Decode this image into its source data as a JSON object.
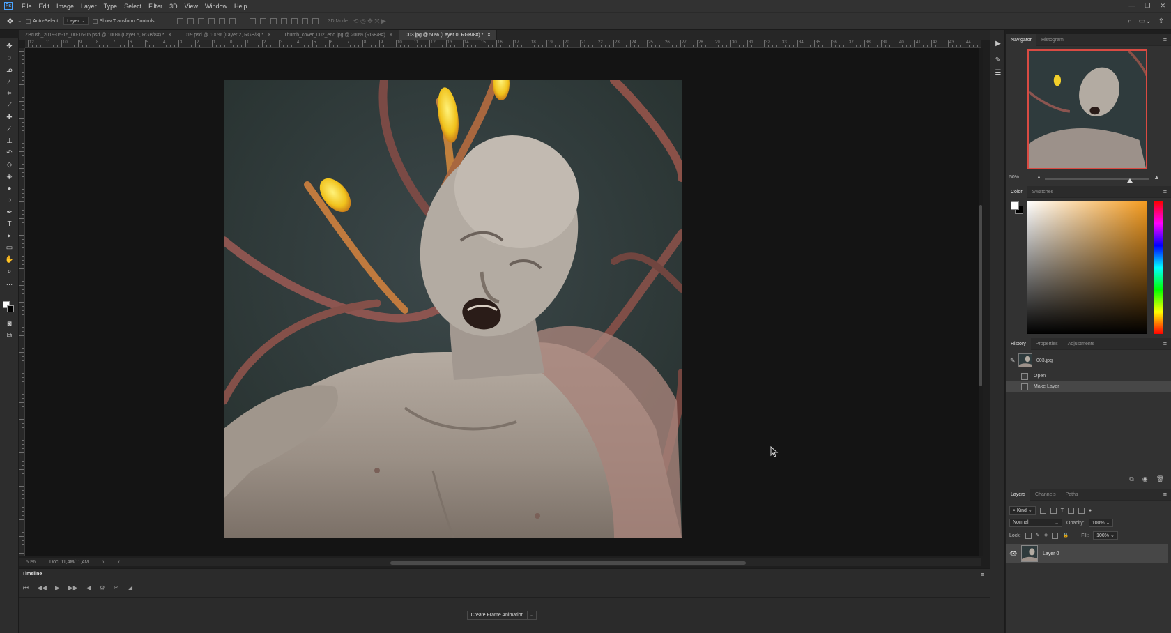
{
  "app": {
    "logo": "Ps"
  },
  "menubar": {
    "items": [
      "File",
      "Edit",
      "Image",
      "Layer",
      "Type",
      "Select",
      "Filter",
      "3D",
      "View",
      "Window",
      "Help"
    ],
    "window_controls": [
      "—",
      "❐",
      "✕"
    ]
  },
  "options": {
    "auto_select_label": "Auto-Select:",
    "auto_select_value": "Layer",
    "show_transform_label": "Show Transform Controls",
    "mode_3d_label": "3D Mode:"
  },
  "tabs": [
    {
      "label": "ZBrush_2019-05-15_00-16-05.psd @ 100% (Layer 5, RGB/8#) *"
    },
    {
      "label": "019.psd @ 100% (Layer 2, RGB/8) *"
    },
    {
      "label": "Thumb_cover_002_end.jpg @ 200% (RGB/8#)"
    },
    {
      "label": "003.jpg @ 50% (Layer 0, RGB/8#) *"
    }
  ],
  "ruler": {
    "h_labels": [
      "12",
      "11",
      "10",
      "9",
      "8",
      "7",
      "6",
      "5",
      "4",
      "3",
      "2",
      "1",
      "0",
      "1",
      "2",
      "3",
      "4",
      "5",
      "6",
      "7",
      "8",
      "9",
      "10",
      "11",
      "12",
      "13",
      "14",
      "15",
      "16",
      "17",
      "18",
      "19",
      "20",
      "21",
      "22",
      "23",
      "24",
      "25",
      "26",
      "27",
      "28",
      "29",
      "30",
      "31",
      "32",
      "33",
      "34",
      "35",
      "36",
      "37",
      "38",
      "39",
      "40",
      "41",
      "42",
      "43",
      "44",
      "45"
    ]
  },
  "status": {
    "zoom": "50%",
    "doc": "Doc: 11,4M/11,4M"
  },
  "timeline": {
    "title": "Timeline",
    "controls": [
      "⏮",
      "◀◀",
      "▶",
      "▶▶",
      "◀",
      "⚙",
      "✂",
      "◪"
    ],
    "create_button": "Create Frame Animation"
  },
  "navigator": {
    "tabs": [
      "Navigator",
      "Histogram"
    ],
    "zoom": "50%"
  },
  "color_panel": {
    "tabs": [
      "Color",
      "Swatches"
    ],
    "fg": "#ffffff",
    "bg": "#000000",
    "hue": "#f39a1e"
  },
  "history": {
    "tabs": [
      "History",
      "Properties",
      "Adjustments"
    ],
    "snapshot": "003.jpg",
    "steps": [
      "Open",
      "Make Layer"
    ]
  },
  "layers": {
    "tabs": [
      "Layers",
      "Channels",
      "Paths"
    ],
    "filter_kind": "Kind",
    "blend_mode": "Normal",
    "opacity_label": "Opacity:",
    "opacity": "100%",
    "lock_label": "Lock:",
    "fill_label": "Fill:",
    "fill": "100%",
    "layer_name": "Layer 0"
  },
  "colors": {
    "accent": "#d94b43",
    "panel": "#323232",
    "canvas_bg": "#141414"
  }
}
